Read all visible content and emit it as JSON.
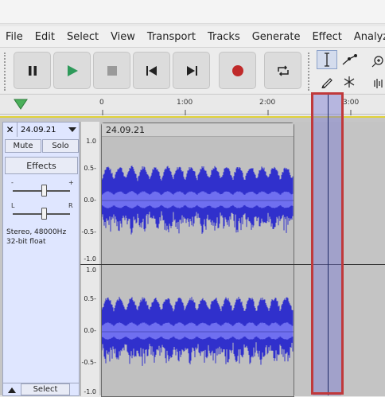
{
  "menu": {
    "items": [
      "File",
      "Edit",
      "Select",
      "View",
      "Transport",
      "Tracks",
      "Generate",
      "Effect",
      "Analyze"
    ]
  },
  "toolbar": {
    "buttons": [
      "pause",
      "play",
      "stop",
      "skip-to-start",
      "skip-to-end",
      "record",
      "loop"
    ],
    "play_color": "#2e9a5a",
    "record_color": "#c02a2a"
  },
  "ruler": {
    "labels": [
      "0",
      "1:00",
      "2:00",
      "3:00"
    ]
  },
  "track": {
    "name": "24.09.21",
    "mute_label": "Mute",
    "solo_label": "Solo",
    "effects_label": "Effects",
    "gain_minus": "-",
    "gain_plus": "+",
    "pan_left": "L",
    "pan_right": "R",
    "info_line1": "Stereo, 48000Hz",
    "info_line2": "32-bit float",
    "select_label": "Select",
    "clip_name": "24.09.21",
    "waveform_color": "#3030cc"
  },
  "vruler": {
    "labels": [
      "1.0",
      "0.5-",
      "0.0-",
      "-0.5-",
      "-1.0"
    ]
  }
}
